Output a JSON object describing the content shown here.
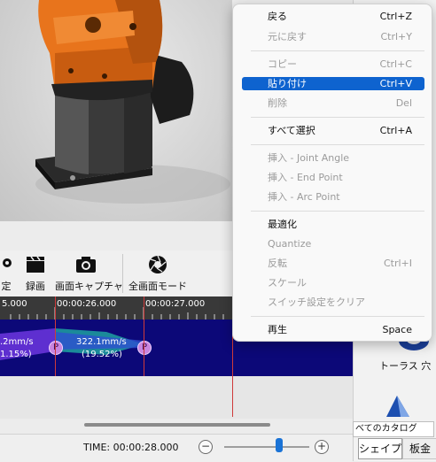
{
  "toolbar": {
    "tools": [
      {
        "label": "定",
        "icon": "gear-icon"
      },
      {
        "label": "録画",
        "icon": "clapperboard-icon"
      },
      {
        "label": "画面キャプチャ",
        "icon": "camera-icon"
      },
      {
        "label": "全画面モード",
        "icon": "aperture-icon"
      }
    ]
  },
  "timeline": {
    "ruler_times": [
      "5.000",
      "00:00:26.000",
      "00:00:27.000"
    ],
    "segments": [
      {
        "speed": ".2mm/s",
        "percent": "1.15%)",
        "marker": "P"
      },
      {
        "speed": "322.1mm/s",
        "percent": "(19.52%)",
        "marker": "P"
      }
    ]
  },
  "status": {
    "time": "TIME: 00:00:28.000",
    "zoom_out": "−",
    "zoom_in": "+",
    "zoom_level": 0.6
  },
  "right_panel": {
    "torus_label": "トーラス 穴",
    "catalog": "べてのカタログ",
    "tabs": [
      "シェイプ",
      "板金"
    ]
  },
  "context_menu": {
    "items": [
      {
        "label": "戻る",
        "shortcut": "Ctrl+Z",
        "enabled": true,
        "highlighted": false
      },
      {
        "label": "元に戻す",
        "shortcut": "Ctrl+Y",
        "enabled": false,
        "highlighted": false
      },
      {
        "label": "コピー",
        "shortcut": "Ctrl+C",
        "enabled": false,
        "highlighted": false
      },
      {
        "label": "貼り付け",
        "shortcut": "Ctrl+V",
        "enabled": true,
        "highlighted": true
      },
      {
        "label": "削除",
        "shortcut": "Del",
        "enabled": false,
        "highlighted": false
      },
      {
        "label": "すべて選択",
        "shortcut": "Ctrl+A",
        "enabled": true,
        "highlighted": false
      },
      {
        "label": "挿入 - Joint Angle",
        "shortcut": "",
        "enabled": false,
        "highlighted": false
      },
      {
        "label": "挿入 - End Point",
        "shortcut": "",
        "enabled": false,
        "highlighted": false
      },
      {
        "label": "挿入 - Arc Point",
        "shortcut": "",
        "enabled": false,
        "highlighted": false
      },
      {
        "label": "最適化",
        "shortcut": "",
        "enabled": true,
        "highlighted": false
      },
      {
        "label": "Quantize",
        "shortcut": "",
        "enabled": false,
        "highlighted": false
      },
      {
        "label": "反転",
        "shortcut": "Ctrl+I",
        "enabled": false,
        "highlighted": false
      },
      {
        "label": "スケール",
        "shortcut": "",
        "enabled": false,
        "highlighted": false
      },
      {
        "label": "スイッチ設定をクリア",
        "shortcut": "",
        "enabled": false,
        "highlighted": false
      },
      {
        "label": "再生",
        "shortcut": "Space",
        "enabled": true,
        "highlighted": false
      }
    ]
  }
}
